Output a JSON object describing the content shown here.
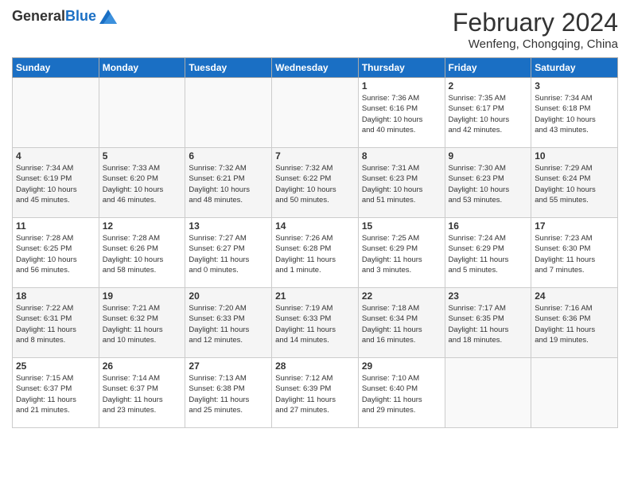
{
  "header": {
    "logo": {
      "general": "General",
      "blue": "Blue"
    },
    "title": "February 2024",
    "location": "Wenfeng, Chongqing, China"
  },
  "days_of_week": [
    "Sunday",
    "Monday",
    "Tuesday",
    "Wednesday",
    "Thursday",
    "Friday",
    "Saturday"
  ],
  "weeks": [
    [
      {
        "day": "",
        "info": ""
      },
      {
        "day": "",
        "info": ""
      },
      {
        "day": "",
        "info": ""
      },
      {
        "day": "",
        "info": ""
      },
      {
        "day": "1",
        "info": "Sunrise: 7:36 AM\nSunset: 6:16 PM\nDaylight: 10 hours\nand 40 minutes."
      },
      {
        "day": "2",
        "info": "Sunrise: 7:35 AM\nSunset: 6:17 PM\nDaylight: 10 hours\nand 42 minutes."
      },
      {
        "day": "3",
        "info": "Sunrise: 7:34 AM\nSunset: 6:18 PM\nDaylight: 10 hours\nand 43 minutes."
      }
    ],
    [
      {
        "day": "4",
        "info": "Sunrise: 7:34 AM\nSunset: 6:19 PM\nDaylight: 10 hours\nand 45 minutes."
      },
      {
        "day": "5",
        "info": "Sunrise: 7:33 AM\nSunset: 6:20 PM\nDaylight: 10 hours\nand 46 minutes."
      },
      {
        "day": "6",
        "info": "Sunrise: 7:32 AM\nSunset: 6:21 PM\nDaylight: 10 hours\nand 48 minutes."
      },
      {
        "day": "7",
        "info": "Sunrise: 7:32 AM\nSunset: 6:22 PM\nDaylight: 10 hours\nand 50 minutes."
      },
      {
        "day": "8",
        "info": "Sunrise: 7:31 AM\nSunset: 6:23 PM\nDaylight: 10 hours\nand 51 minutes."
      },
      {
        "day": "9",
        "info": "Sunrise: 7:30 AM\nSunset: 6:23 PM\nDaylight: 10 hours\nand 53 minutes."
      },
      {
        "day": "10",
        "info": "Sunrise: 7:29 AM\nSunset: 6:24 PM\nDaylight: 10 hours\nand 55 minutes."
      }
    ],
    [
      {
        "day": "11",
        "info": "Sunrise: 7:28 AM\nSunset: 6:25 PM\nDaylight: 10 hours\nand 56 minutes."
      },
      {
        "day": "12",
        "info": "Sunrise: 7:28 AM\nSunset: 6:26 PM\nDaylight: 10 hours\nand 58 minutes."
      },
      {
        "day": "13",
        "info": "Sunrise: 7:27 AM\nSunset: 6:27 PM\nDaylight: 11 hours\nand 0 minutes."
      },
      {
        "day": "14",
        "info": "Sunrise: 7:26 AM\nSunset: 6:28 PM\nDaylight: 11 hours\nand 1 minute."
      },
      {
        "day": "15",
        "info": "Sunrise: 7:25 AM\nSunset: 6:29 PM\nDaylight: 11 hours\nand 3 minutes."
      },
      {
        "day": "16",
        "info": "Sunrise: 7:24 AM\nSunset: 6:29 PM\nDaylight: 11 hours\nand 5 minutes."
      },
      {
        "day": "17",
        "info": "Sunrise: 7:23 AM\nSunset: 6:30 PM\nDaylight: 11 hours\nand 7 minutes."
      }
    ],
    [
      {
        "day": "18",
        "info": "Sunrise: 7:22 AM\nSunset: 6:31 PM\nDaylight: 11 hours\nand 8 minutes."
      },
      {
        "day": "19",
        "info": "Sunrise: 7:21 AM\nSunset: 6:32 PM\nDaylight: 11 hours\nand 10 minutes."
      },
      {
        "day": "20",
        "info": "Sunrise: 7:20 AM\nSunset: 6:33 PM\nDaylight: 11 hours\nand 12 minutes."
      },
      {
        "day": "21",
        "info": "Sunrise: 7:19 AM\nSunset: 6:33 PM\nDaylight: 11 hours\nand 14 minutes."
      },
      {
        "day": "22",
        "info": "Sunrise: 7:18 AM\nSunset: 6:34 PM\nDaylight: 11 hours\nand 16 minutes."
      },
      {
        "day": "23",
        "info": "Sunrise: 7:17 AM\nSunset: 6:35 PM\nDaylight: 11 hours\nand 18 minutes."
      },
      {
        "day": "24",
        "info": "Sunrise: 7:16 AM\nSunset: 6:36 PM\nDaylight: 11 hours\nand 19 minutes."
      }
    ],
    [
      {
        "day": "25",
        "info": "Sunrise: 7:15 AM\nSunset: 6:37 PM\nDaylight: 11 hours\nand 21 minutes."
      },
      {
        "day": "26",
        "info": "Sunrise: 7:14 AM\nSunset: 6:37 PM\nDaylight: 11 hours\nand 23 minutes."
      },
      {
        "day": "27",
        "info": "Sunrise: 7:13 AM\nSunset: 6:38 PM\nDaylight: 11 hours\nand 25 minutes."
      },
      {
        "day": "28",
        "info": "Sunrise: 7:12 AM\nSunset: 6:39 PM\nDaylight: 11 hours\nand 27 minutes."
      },
      {
        "day": "29",
        "info": "Sunrise: 7:10 AM\nSunset: 6:40 PM\nDaylight: 11 hours\nand 29 minutes."
      },
      {
        "day": "",
        "info": ""
      },
      {
        "day": "",
        "info": ""
      }
    ]
  ]
}
